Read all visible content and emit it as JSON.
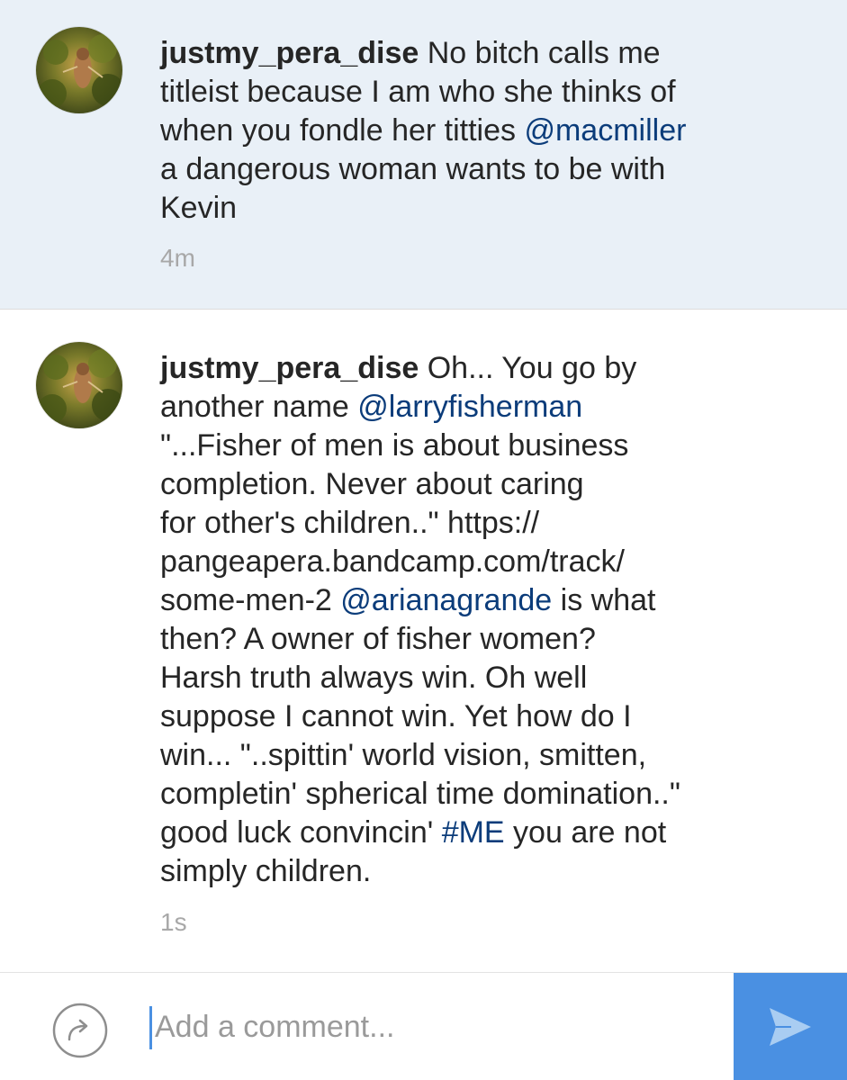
{
  "comments": [
    {
      "username": "justmy_pera_dise",
      "timestamp": "4m",
      "highlighted": true,
      "lines": [
        [
          {
            "t": "username",
            "v": "justmy_pera_dise"
          },
          {
            "t": "text",
            "v": " No bitch calls me"
          }
        ],
        [
          {
            "t": "text",
            "v": "titleist because I am who she thinks of"
          }
        ],
        [
          {
            "t": "text",
            "v": "when you fondle her titties "
          },
          {
            "t": "mention",
            "v": "@macmiller"
          }
        ],
        [
          {
            "t": "text",
            "v": "a dangerous woman wants to be with"
          }
        ],
        [
          {
            "t": "text",
            "v": "Kevin"
          }
        ]
      ]
    },
    {
      "username": "justmy_pera_dise",
      "timestamp": "1s",
      "highlighted": false,
      "lines": [
        [
          {
            "t": "username",
            "v": "justmy_pera_dise"
          },
          {
            "t": "text",
            "v": " Oh... You go by"
          }
        ],
        [
          {
            "t": "text",
            "v": "another name "
          },
          {
            "t": "mention",
            "v": "@larryfisherman"
          }
        ],
        [
          {
            "t": "text",
            "v": "\"...Fisher of men is about business"
          }
        ],
        [
          {
            "t": "text",
            "v": "completion. Never about caring"
          }
        ],
        [
          {
            "t": "text",
            "v": "for other's children..\" https://"
          }
        ],
        [
          {
            "t": "text",
            "v": "pangeapera.bandcamp.com/track/"
          }
        ],
        [
          {
            "t": "text",
            "v": "some-men-2 "
          },
          {
            "t": "mention",
            "v": "@arianagrande"
          },
          {
            "t": "text",
            "v": " is what"
          }
        ],
        [
          {
            "t": "text",
            "v": "then? A owner of fisher women?"
          }
        ],
        [
          {
            "t": "text",
            "v": "Harsh truth always win. Oh well"
          }
        ],
        [
          {
            "t": "text",
            "v": "suppose I cannot win. Yet how do I"
          }
        ],
        [
          {
            "t": "text",
            "v": "win... \"..spittin' world vision, smitten,"
          }
        ],
        [
          {
            "t": "text",
            "v": "completin' spherical time domination..\""
          }
        ],
        [
          {
            "t": "text",
            "v": "good luck convincin' "
          },
          {
            "t": "hashtag",
            "v": "#ME"
          },
          {
            "t": "text",
            "v": " you are not"
          }
        ],
        [
          {
            "t": "text",
            "v": "simply children."
          }
        ]
      ]
    }
  ],
  "composer": {
    "placeholder": "Add a comment...",
    "value": "",
    "reply_icon": "reply-arrow-icon",
    "send_icon": "send-paper-plane-icon"
  },
  "colors": {
    "highlight_bg": "#e9f0f7",
    "link": "#0b3c7a",
    "timestamp": "#a8a8a8",
    "send_button": "#4a90e2"
  }
}
